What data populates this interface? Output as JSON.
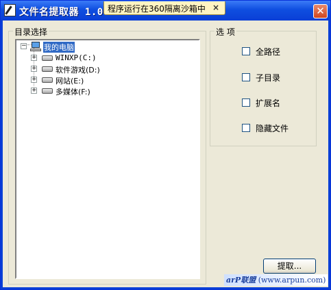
{
  "window": {
    "title": "文件名提取器 1.0",
    "close_label": "✕"
  },
  "sandbox": {
    "label": "程序运行在360隔离沙箱中",
    "close_label": "×"
  },
  "directory_group": {
    "legend": "目录选择",
    "tree": {
      "root_label": "我的电脑",
      "drives": [
        {
          "label": "WINXP(C:)"
        },
        {
          "label": "软件游戏(D:)"
        },
        {
          "label": "网站(E:)"
        },
        {
          "label": "多媒体(F:)"
        }
      ]
    }
  },
  "options_group": {
    "legend": "选 项",
    "options": [
      {
        "label": "全路径",
        "checked": false
      },
      {
        "label": "子目录",
        "checked": false
      },
      {
        "label": "扩展名",
        "checked": false
      },
      {
        "label": "隐藏文件",
        "checked": false
      }
    ]
  },
  "extract_button": {
    "label": "提取..."
  },
  "footer": {
    "brand": "arP联盟",
    "url": "(www.arpun.com)"
  },
  "colors": {
    "titlebar": "#0a3fd6",
    "client": "#ece9d8",
    "selection": "#316ac5",
    "sandbox_tab": "#fff4c2"
  }
}
